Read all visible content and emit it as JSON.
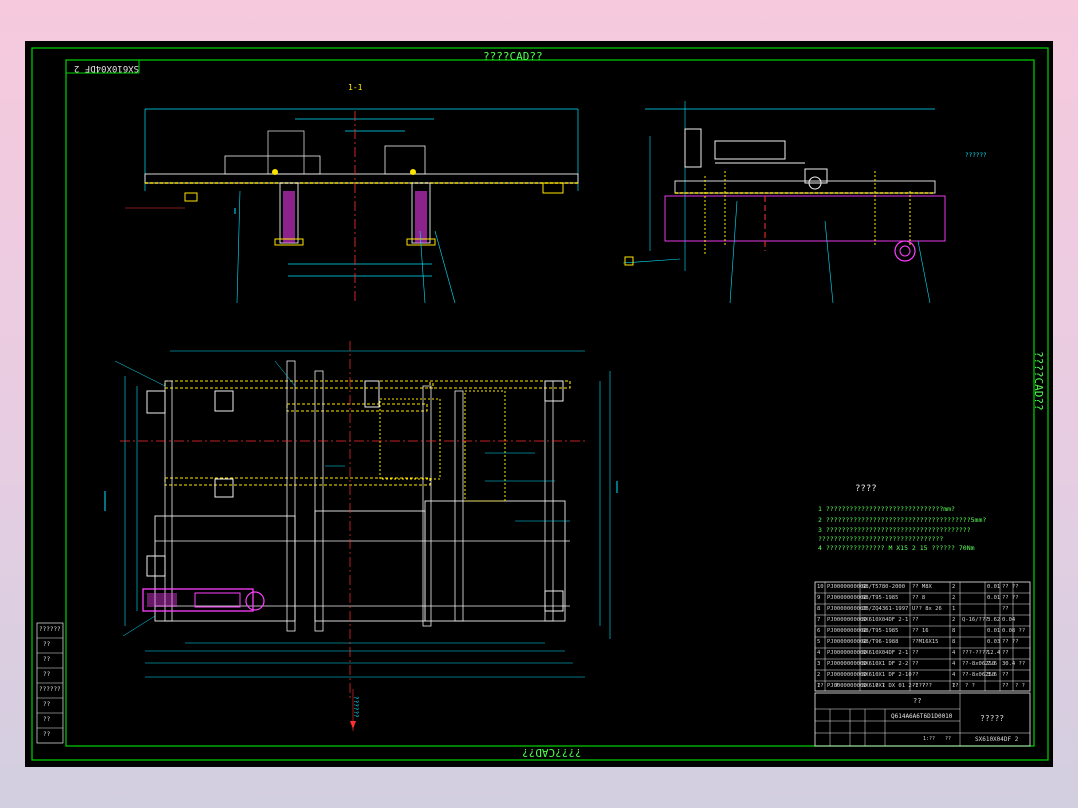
{
  "header_text": "????CAD??",
  "right_side_text": "????CAD??",
  "footer_text": "????CAD??",
  "drawing_number_flipped": "SX610X04DF 2",
  "section_label": "1-1",
  "right_arrow_label": "??????",
  "left_stack_labels": [
    "??????",
    "??",
    "??",
    "??",
    "??????",
    "??",
    "??",
    "??"
  ],
  "bottom_arrow_label": "??????",
  "notes": {
    "title": "????",
    "lines": [
      "1 ??????????????????????????????mm?",
      "2 ?????????????????????????????????????5mm?",
      "3 ?????????????????????????????????????",
      "  ????????????????????????????????",
      "4 ??????????????? M X15 2 15 ?????? 70Nm"
    ]
  },
  "bom": {
    "rows": [
      {
        "n": "10",
        "code": "PJ0000000000",
        "std": "GB/T5780-2000",
        "name": "?? M8X",
        "qty": "2",
        "mat": "",
        "w": "0.01",
        "note": "?? ??"
      },
      {
        "n": "9",
        "code": "PJ0000000000",
        "std": "GB/T95-1985",
        "name": "?? 8",
        "qty": "2",
        "mat": "",
        "w": "0.01",
        "note": "?? ??"
      },
      {
        "n": "8",
        "code": "PJ0000000000",
        "std": "JB/ZQ4361-1997",
        "name": "U?? 8x 26",
        "qty": "1",
        "mat": "",
        "w": "",
        "note": "??"
      },
      {
        "n": "7",
        "code": "PJ0000000000",
        "std": "SX610X04DF 2-1",
        "name": "??",
        "qty": "2",
        "mat": "Q-16/???",
        "w": "3.62",
        "note": "0.04"
      },
      {
        "n": "6",
        "code": "PJ0000000000",
        "std": "GB/T95-1985",
        "name": "?? 16",
        "qty": "8",
        "mat": "",
        "w": "0.01",
        "note": "0.08 ??"
      },
      {
        "n": "5",
        "code": "PJ0000000000",
        "std": "GB/T96-1988",
        "name": "??M16X15",
        "qty": "8",
        "mat": "",
        "w": "0.03",
        "note": "?? ??"
      },
      {
        "n": "4",
        "code": "PJ0000000000",
        "std": "SX610X04DF 2-1",
        "name": "??",
        "qty": "4",
        "mat": "???-????",
        "w": "12.4",
        "note": "??"
      },
      {
        "n": "3",
        "code": "PJ0000000000",
        "std": "SX610X1 DF 2-2",
        "name": "??",
        "qty": "4",
        "mat": "??-8x06250",
        "w": "7.6",
        "note": "30.4 ??"
      },
      {
        "n": "2",
        "code": "PJ0000000000",
        "std": "SX610X1 DF 2-10",
        "name": "??",
        "qty": "4",
        "mat": "??-8x06250",
        "w": "3.6",
        "note": "??"
      },
      {
        "n": "1",
        "code": "PJ0000000000",
        "std": "SX610X1 DX 01 2-1",
        "name": "?????",
        "qty": "1",
        "mat": "",
        "w": "",
        "note": "??"
      }
    ],
    "header": [
      "??",
      "?",
      "?",
      "? ?",
      "? ?",
      "??",
      "? ?",
      "? ?",
      "? ?"
    ]
  },
  "title_block": {
    "title": "??",
    "part_code": "Q614A6A6T6D1D0010",
    "drawing_name": "?????",
    "drawing_no": "SX610X04DF 2",
    "scale": "1:??",
    "sheet": "??"
  },
  "colors": {
    "frame": "#00e000",
    "dimension": "#00e5ff",
    "yellow": "#ffe600",
    "white": "#f0f0f0",
    "magenta": "#ff40ff",
    "red": "#ff3030"
  }
}
